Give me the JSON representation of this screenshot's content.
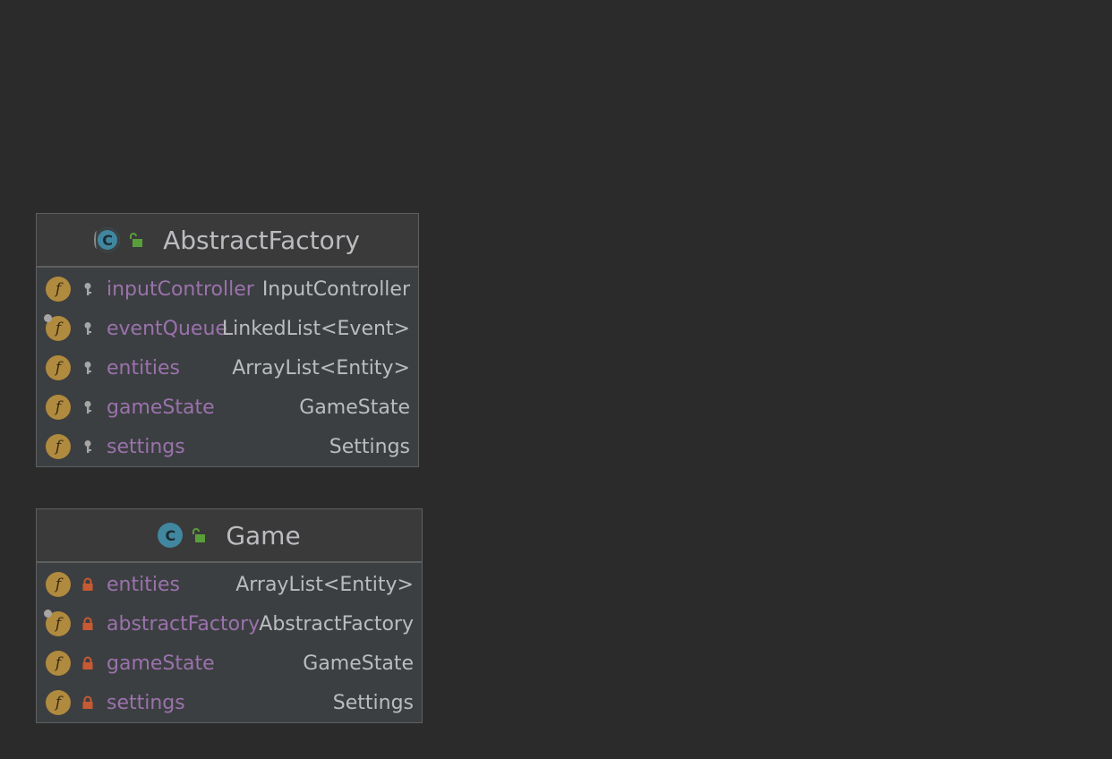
{
  "diagram": {
    "classes": [
      {
        "name": "AbstractFactory",
        "kind": "abstract-class",
        "visibility": "public",
        "fields": [
          {
            "name": "inputController",
            "type": "InputController",
            "visibility": "package",
            "icon": "field-icon",
            "annotated": false
          },
          {
            "name": "eventQueue",
            "type": "LinkedList<Event>",
            "visibility": "package",
            "icon": "field-icon",
            "annotated": true
          },
          {
            "name": "entities",
            "type": "ArrayList<Entity>",
            "visibility": "package",
            "icon": "field-icon",
            "annotated": false
          },
          {
            "name": "gameState",
            "type": "GameState",
            "visibility": "package",
            "icon": "field-icon",
            "annotated": false
          },
          {
            "name": "settings",
            "type": "Settings",
            "visibility": "package",
            "icon": "field-icon",
            "annotated": false
          }
        ]
      },
      {
        "name": "Game",
        "kind": "class",
        "visibility": "public",
        "fields": [
          {
            "name": "entities",
            "type": "ArrayList<Entity>",
            "visibility": "private",
            "icon": "field-icon",
            "annotated": false
          },
          {
            "name": "abstractFactory",
            "type": "AbstractFactory",
            "visibility": "private",
            "icon": "field-icon",
            "annotated": true
          },
          {
            "name": "gameState",
            "type": "GameState",
            "visibility": "private",
            "icon": "field-icon",
            "annotated": false
          },
          {
            "name": "settings",
            "type": "Settings",
            "visibility": "private",
            "icon": "field-icon",
            "annotated": false
          }
        ]
      }
    ],
    "class_icon_letter": "C",
    "field_icon_letter": "f",
    "colors": {
      "background": "#2b2b2b",
      "box": "#3c3f41",
      "border": "#5e6060",
      "class_icon": "#40879f",
      "field_icon": "#b08a3e",
      "field_name": "#9a72ac",
      "type_text": "#bbbcc0",
      "public_lock": "#5a9e3a",
      "private_lock": "#c75a32",
      "package_key": "#a6a6a6"
    }
  }
}
